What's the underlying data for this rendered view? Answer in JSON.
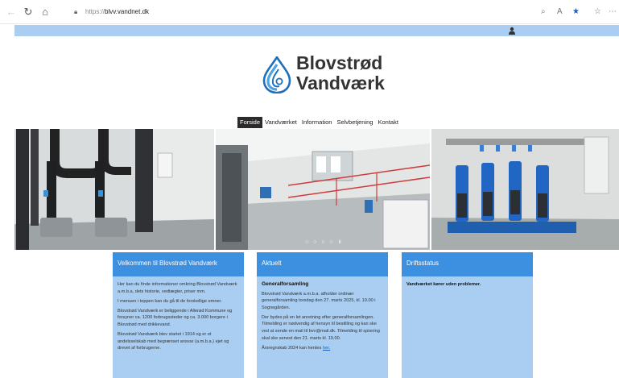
{
  "browser": {
    "url_protocol": "https://",
    "url_host": "blvv.vandnet.dk"
  },
  "logo": {
    "line1": "Blovstrød",
    "line2": "Vandværk",
    "colors": {
      "blue": "#1f6fbf",
      "light_blue": "#4fa3e0",
      "text": "#333333"
    }
  },
  "menu": {
    "items": [
      "Forside",
      "Vandværket",
      "Information",
      "Selvbetjening",
      "Kontakt"
    ],
    "active_index": 0
  },
  "hero": {
    "slider_dots": "○ ○ ○ ○ ॥"
  },
  "columns": {
    "welcome": {
      "title": "Velkommen til Blovstrød Vandværk",
      "paragraphs": [
        "Her kan du finde informationer omkring Blovstrød Vandværk a.m.b.a, dets historie, vedtægter, priser mm.",
        "I menuen i toppen kan du gå til de forskellige emner.",
        "Blovstrød Vandværk er beliggende i Allerød Kommune og forsyner ca. 1200 forbrugssteder og ca. 3.000 borgere i Blovstrød med drikkevand.",
        "Blovstrød Vandværk blev startet i 1914 og er et andelsselskab med begrænset ansvar (a.m.b.a.) ejet og drevet af forbrugerne."
      ]
    },
    "news": {
      "title": "Aktuelt",
      "heading": "Generalforsamling",
      "paragraphs": [
        "Blovstrød Vandværk a.m.b.a. afholder ordinær generalforsamling torsdag den 27. marts 2025, kl. 19.00 i Sognegården.",
        "Der bydes på en let anretning efter generalforsamlingen. Tilmelding er nødvendig af hensyn til bestilling og kan ske ved at sende en mail til bvv@mail.dk. Tilmelding til spisning skal ske senest den 21. marts kl. 19.00."
      ],
      "annual_report_text": "Årsregnskab 2024 kan hentes ",
      "annual_report_link": "her."
    },
    "status": {
      "title": "Driftsstatus",
      "message": "Vandværket kører uden problemer."
    }
  },
  "colors": {
    "strip": "#a9cef2",
    "column_bg": "#a9cef2",
    "column_header": "#3d8fe0",
    "menu_active": "#2b2b2b"
  }
}
